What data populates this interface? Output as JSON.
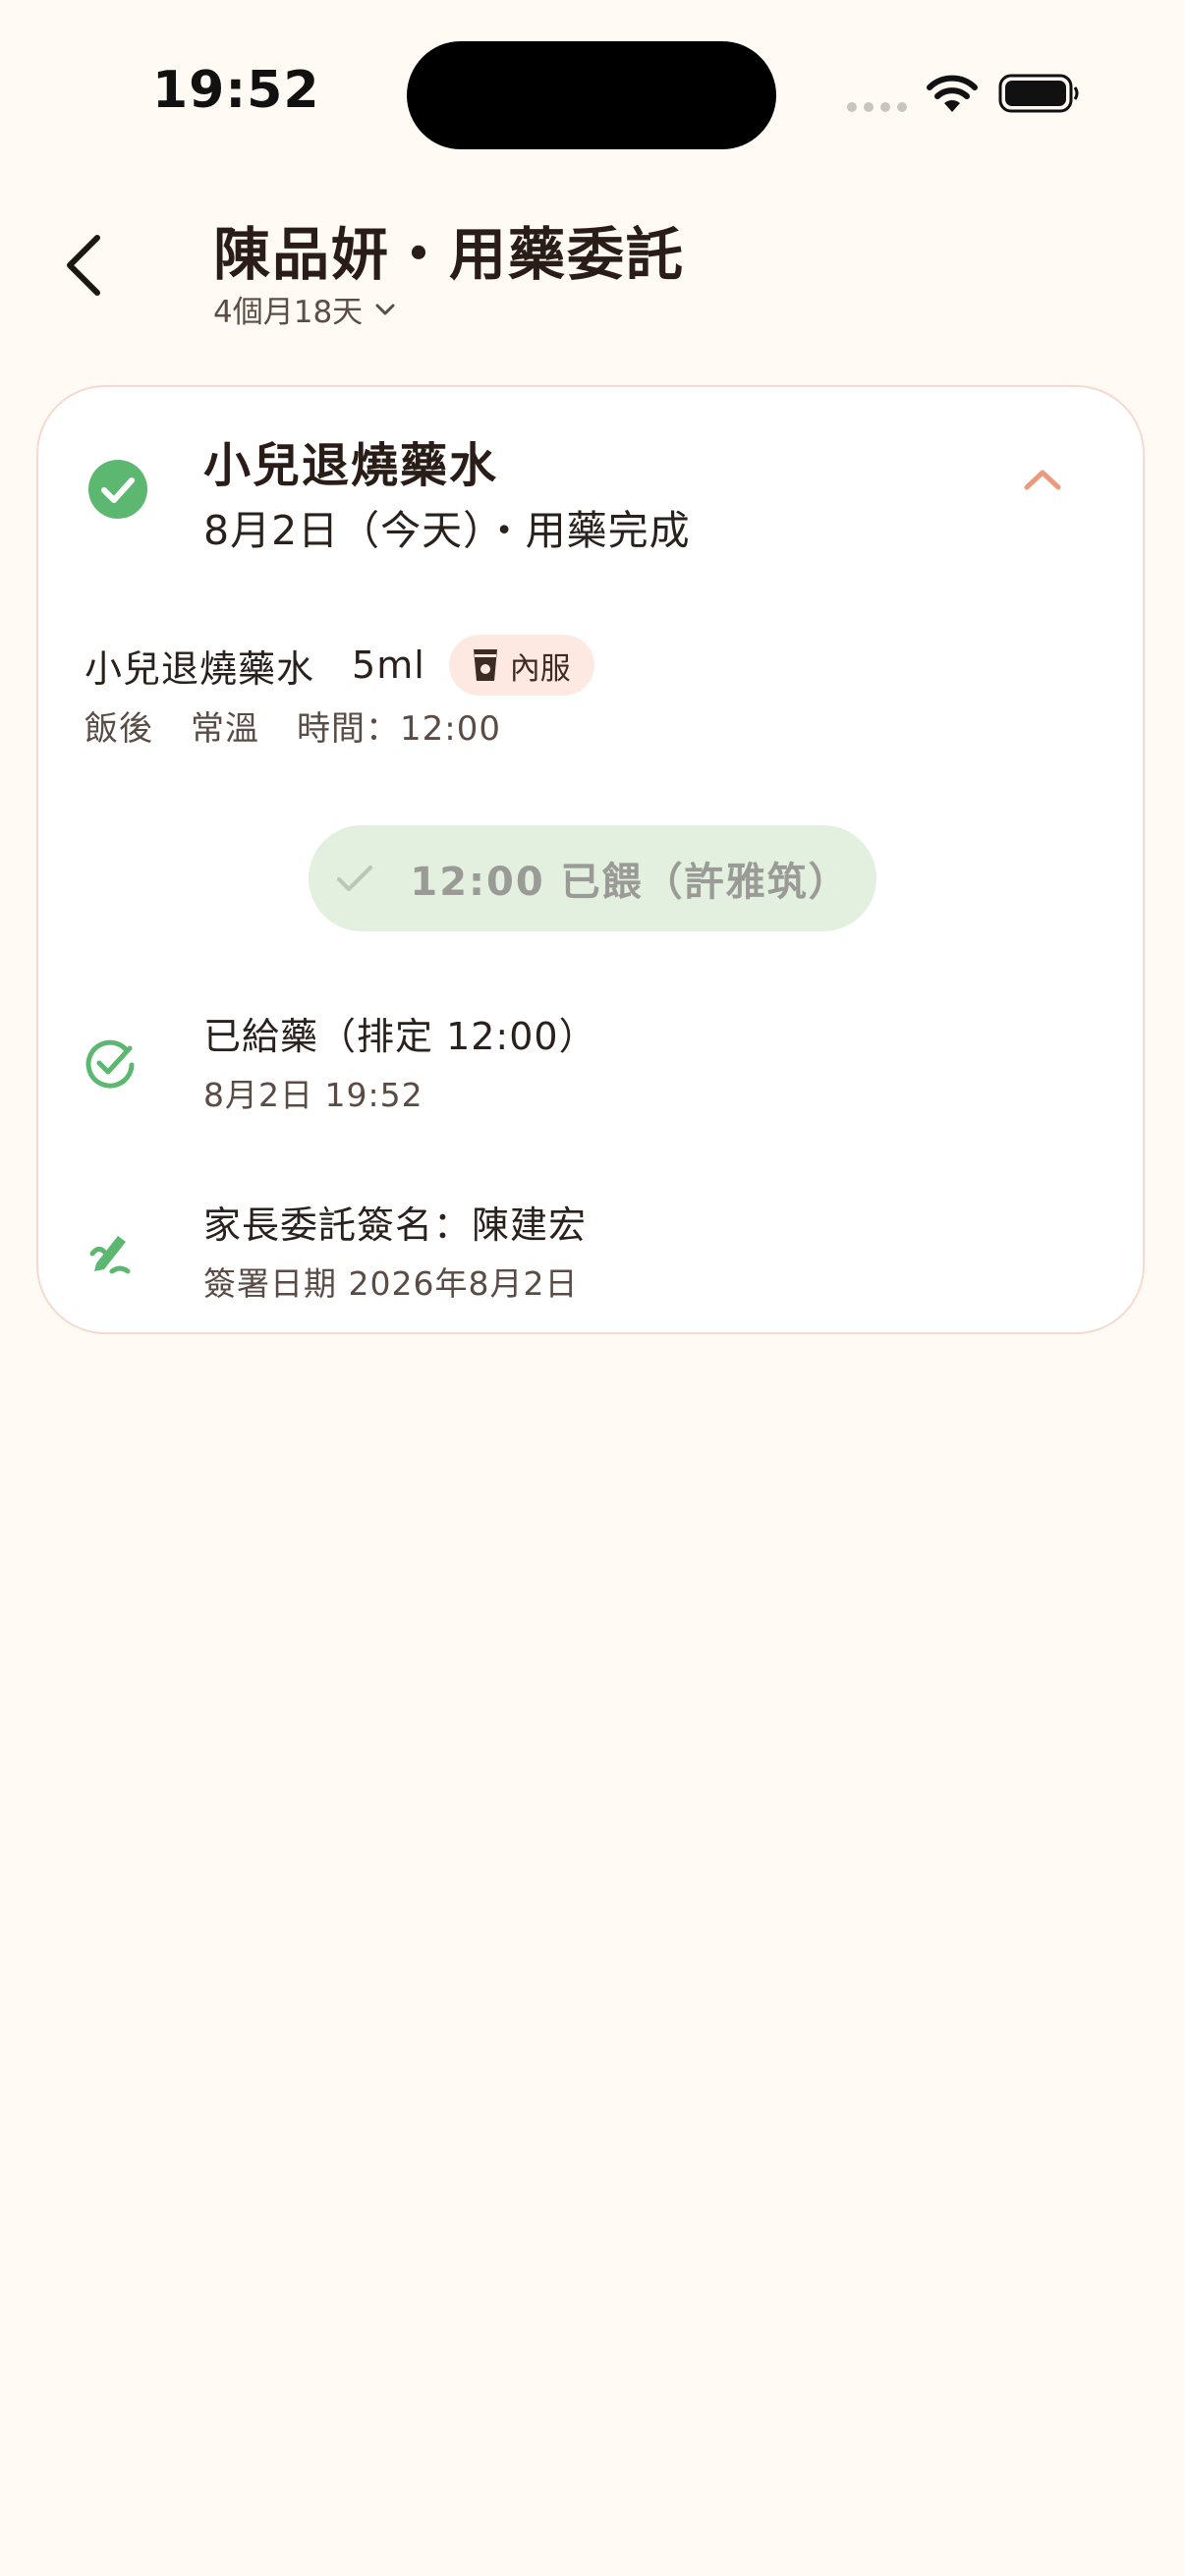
{
  "status_bar": {
    "time": "19:52"
  },
  "nav": {
    "title": "陳品妍・用藥委託",
    "age": "4個月18天"
  },
  "card": {
    "title": "小兒退燒藥水",
    "subtitle": "8月2日（今天）・用藥完成",
    "medication": {
      "name": "小兒退燒藥水",
      "dose": "5ml",
      "route": "內服",
      "timing": "飯後",
      "storage": "常溫",
      "time": "時間：12:00"
    },
    "fed_button_label": "12:00 已餵（許雅筑）",
    "logs": [
      {
        "title": "已給藥（排定 12:00）",
        "subtitle": "8月2日 19:52"
      },
      {
        "title": "家長委託簽名：陳建宏",
        "subtitle": "簽署日期 2026年8月2日"
      }
    ]
  },
  "colors": {
    "background": "#fffaf3",
    "accent_green": "#5cb870",
    "accent_orange": "#ec9a7c",
    "badge_bg": "#fde9e2",
    "fed_button_bg": "#e3efdf"
  },
  "icons": {
    "back": "chevron-left-icon",
    "dropdown": "chevron-down-icon",
    "status": "check-circle-filled-icon",
    "collapse": "chevron-up-icon",
    "route": "medicine-cup-icon",
    "fed": "checkmark-icon",
    "given": "check-circle-outline-icon",
    "signature": "signature-pen-icon"
  }
}
